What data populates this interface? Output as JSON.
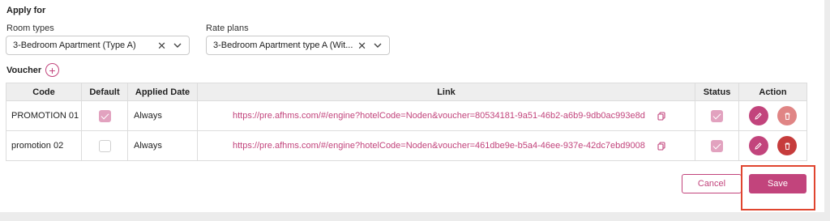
{
  "apply_for": {
    "title": "Apply for",
    "room_types": {
      "label": "Room types",
      "value": "3-Bedroom Apartment (Type A)"
    },
    "rate_plans": {
      "label": "Rate plans",
      "value": "3-Bedroom Apartment type A (Wit..."
    }
  },
  "voucher": {
    "label": "Voucher",
    "add_icon": "plus-circle-icon",
    "columns": [
      "Code",
      "Default",
      "Applied Date",
      "Link",
      "Status",
      "Action"
    ],
    "rows": [
      {
        "code": "PROMOTION 01",
        "default": true,
        "applied_date": "Always",
        "link": "https://pre.afhms.com/#/engine?hotelCode=Noden&voucher=80534181-9a51-46b2-a6b9-9db0ac993e8d",
        "status": true,
        "delete_enabled": false
      },
      {
        "code": "promotion 02",
        "default": false,
        "applied_date": "Always",
        "link": "https://pre.afhms.com/#/engine?hotelCode=Noden&voucher=461dbe9e-b5a4-46ee-937e-42dc7ebd9008",
        "status": true,
        "delete_enabled": true
      }
    ]
  },
  "footer": {
    "cancel_label": "Cancel",
    "save_label": "Save"
  },
  "colors": {
    "accent": "#c2447c",
    "delete": "#c63c3c",
    "highlight": "#e0452f"
  }
}
